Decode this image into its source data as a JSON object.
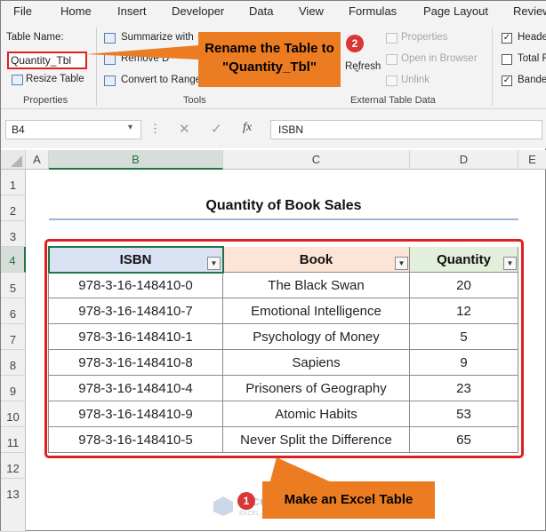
{
  "menu": [
    "File",
    "Home",
    "Insert",
    "Developer",
    "Data",
    "View",
    "Formulas",
    "Page Layout",
    "Review"
  ],
  "ribbon": {
    "properties": {
      "table_name_label": "Table Name:",
      "table_name_value": "Quantity_Tbl",
      "resize_table": "Resize Table",
      "group_label": "Properties"
    },
    "tools": {
      "summarize": "Summarize with",
      "remove_duplicates": "Remove D",
      "convert_to_range": "Convert to Range",
      "group_label": "Tools"
    },
    "external": {
      "refresh": "Refresh",
      "properties": "Properties",
      "open_in_browser": "Open in Browser",
      "unlink": "Unlink",
      "group_label": "External Table Data"
    },
    "style_options": {
      "header_row": "Heade",
      "total_row": "Total R",
      "banded_rows": "Bande"
    }
  },
  "callouts": {
    "rename": "Rename the Table to \"Quantity_Tbl\"",
    "rename_step": "2",
    "make_table": "Make an Excel Table",
    "make_step": "1"
  },
  "formula_bar": {
    "name_box": "B4",
    "formula": "ISBN"
  },
  "grid": {
    "columns": [
      "A",
      "B",
      "C",
      "D",
      "E"
    ],
    "rows": [
      "1",
      "2",
      "3",
      "4",
      "5",
      "6",
      "7",
      "8",
      "9",
      "10",
      "11",
      "12",
      "13"
    ]
  },
  "sheet": {
    "title": "Quantity of Book Sales",
    "headers": [
      "ISBN",
      "Book",
      "Quantity"
    ],
    "rows": [
      {
        "isbn": "978-3-16-148410-0",
        "book": "The Black Swan",
        "qty": "20"
      },
      {
        "isbn": "978-3-16-148410-7",
        "book": "Emotional Intelligence",
        "qty": "12"
      },
      {
        "isbn": "978-3-16-148410-1",
        "book": "Psychology of Money",
        "qty": "5"
      },
      {
        "isbn": "978-3-16-148410-8",
        "book": "Sapiens",
        "qty": "9"
      },
      {
        "isbn": "978-3-16-148410-4",
        "book": "Prisoners of Geography",
        "qty": "23"
      },
      {
        "isbn": "978-3-16-148410-9",
        "book": "Atomic Habits",
        "qty": "53"
      },
      {
        "isbn": "978-3-16-148410-5",
        "book": "Never Split the Difference",
        "qty": "65"
      }
    ]
  },
  "watermark": {
    "brand": "exceldemy",
    "tagline": "EXCEL · DATA · BI"
  },
  "colors": {
    "callout": "#ec7c22",
    "highlight": "#e02020",
    "badge": "#d93636",
    "isbn_header": "#d9e1f2",
    "book_header": "#fce4d6",
    "qty_header": "#e2efda"
  }
}
